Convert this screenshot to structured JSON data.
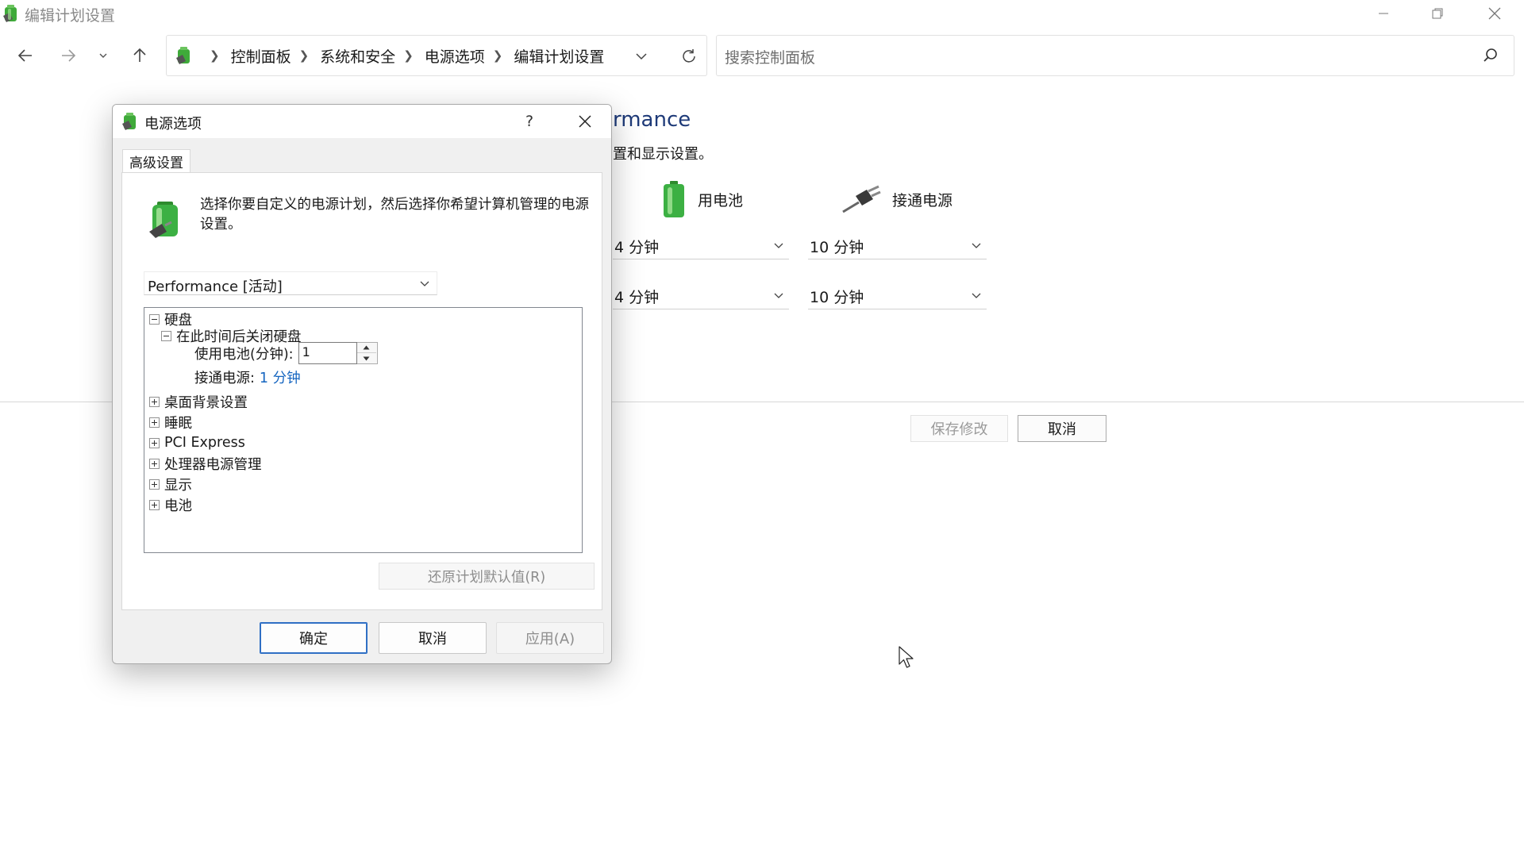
{
  "window": {
    "title": "编辑计划设置",
    "address": {
      "crumbs": [
        "控制面板",
        "系统和安全",
        "电源选项",
        "编辑计划设置"
      ]
    },
    "search": {
      "placeholder": "搜索控制面板"
    }
  },
  "background": {
    "title_fragment": "rmance",
    "desc_fragment": "置和显示设置。",
    "col_battery": "用电池",
    "col_ac": "接通电源",
    "rows": [
      {
        "battery": "4 分钟",
        "ac": "10 分钟"
      },
      {
        "battery": "4 分钟",
        "ac": "10 分钟"
      }
    ],
    "save_label": "保存修改",
    "cancel_label": "取消"
  },
  "dialog": {
    "title": "电源选项",
    "help": "?",
    "tab_label": "高级设置",
    "description": "选择你要自定义的电源计划，然后选择你希望计算机管理的电源设置。",
    "plan_selected": "Performance [活动]",
    "tree": {
      "disk": "硬盘",
      "disk_off": "在此时间后关闭硬盘",
      "battery_label": "使用电池(分钟):",
      "battery_value": "1",
      "ac_label": "接通电源:",
      "ac_value": "1 分钟",
      "desktop_bg": "桌面背景设置",
      "sleep": "睡眠",
      "pci": "PCI Express",
      "cpu": "处理器电源管理",
      "display": "显示",
      "battery": "电池"
    },
    "restore_label": "还原计划默认值(R)",
    "ok_label": "确定",
    "cancel_label": "取消",
    "apply_label": "应用(A)"
  },
  "colors": {
    "accent": "#2f6fc4",
    "link": "#1565c0",
    "title_blue": "#1e3a78"
  }
}
